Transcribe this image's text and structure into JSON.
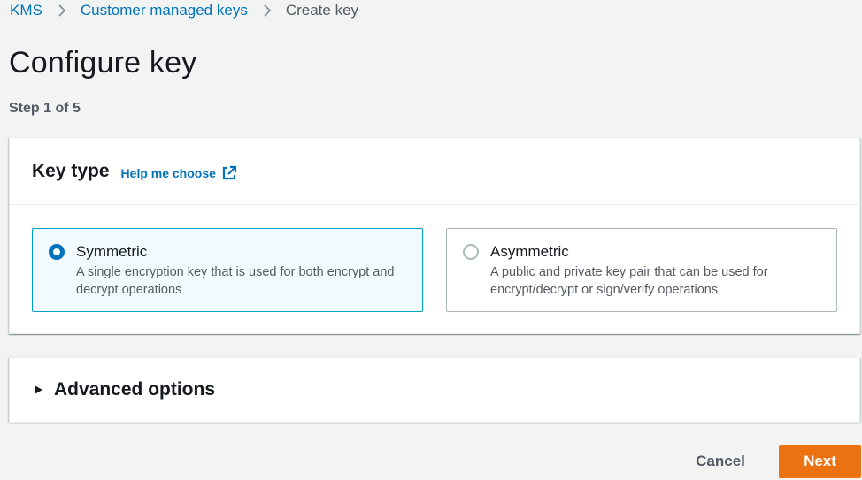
{
  "breadcrumb": {
    "items": [
      {
        "label": "KMS"
      },
      {
        "label": "Customer managed keys"
      },
      {
        "label": "Create key"
      }
    ]
  },
  "page": {
    "title": "Configure key",
    "step": "Step 1 of 5"
  },
  "key_type": {
    "title": "Key type",
    "help_link": "Help me choose",
    "options": [
      {
        "label": "Symmetric",
        "description": "A single encryption key that is used for both encrypt and decrypt operations",
        "selected": true
      },
      {
        "label": "Asymmetric",
        "description": "A public and private key pair that can be used for encrypt/decrypt or sign/verify operations",
        "selected": false
      }
    ]
  },
  "advanced": {
    "label": "Advanced options",
    "expanded": false
  },
  "actions": {
    "cancel_label": "Cancel",
    "next_label": "Next"
  },
  "colors": {
    "link": "#0073bb",
    "primary_button": "#ec7211",
    "selected_border": "#00a1c9",
    "selected_background": "#f1faff",
    "page_background": "#f2f3f3"
  }
}
